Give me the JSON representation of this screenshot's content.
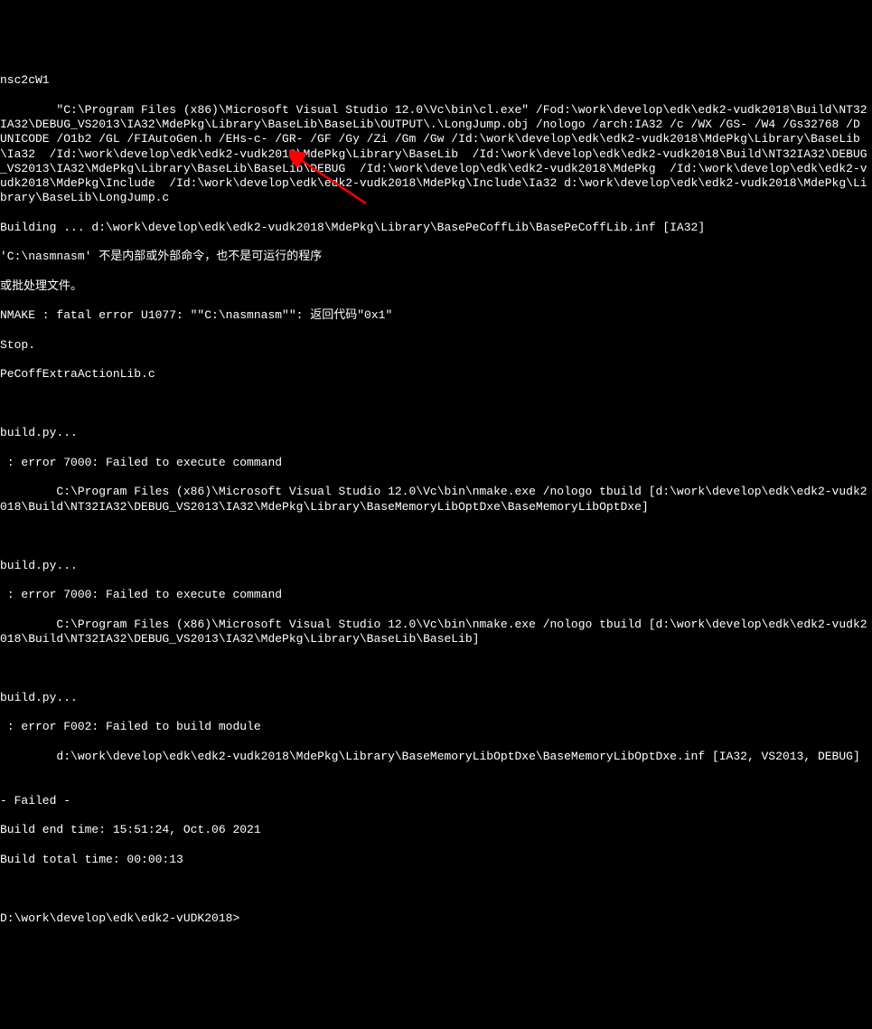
{
  "terminal": {
    "lines": [
      "nsc2cW1",
      "        \"C:\\Program Files (x86)\\Microsoft Visual Studio 12.0\\Vc\\bin\\cl.exe\" /Fod:\\work\\develop\\edk\\edk2-vudk2018\\Build\\NT32IA32\\DEBUG_VS2013\\IA32\\MdePkg\\Library\\BaseLib\\BaseLib\\OUTPUT\\.\\LongJump.obj /nologo /arch:IA32 /c /WX /GS- /W4 /Gs32768 /D UNICODE /O1b2 /GL /FIAutoGen.h /EHs-c- /GR- /GF /Gy /Zi /Gm /Gw /Id:\\work\\develop\\edk\\edk2-vudk2018\\MdePkg\\Library\\BaseLib\\Ia32  /Id:\\work\\develop\\edk\\edk2-vudk2018\\MdePkg\\Library\\BaseLib  /Id:\\work\\develop\\edk\\edk2-vudk2018\\Build\\NT32IA32\\DEBUG_VS2013\\IA32\\MdePkg\\Library\\BaseLib\\BaseLib\\DEBUG  /Id:\\work\\develop\\edk\\edk2-vudk2018\\MdePkg  /Id:\\work\\develop\\edk\\edk2-vudk2018\\MdePkg\\Include  /Id:\\work\\develop\\edk\\edk2-vudk2018\\MdePkg\\Include\\Ia32 d:\\work\\develop\\edk\\edk2-vudk2018\\MdePkg\\Library\\BaseLib\\LongJump.c",
      "Building ... d:\\work\\develop\\edk\\edk2-vudk2018\\MdePkg\\Library\\BasePeCoffLib\\BasePeCoffLib.inf [IA32]",
      "'C:\\nasmnasm' 不是内部或外部命令，也不是可运行的程序",
      "或批处理文件。",
      "NMAKE : fatal error U1077: \"\"C:\\nasmnasm\"\": 返回代码\"0x1\"",
      "Stop.",
      "PeCoffExtraActionLib.c",
      "",
      "",
      "build.py...",
      " : error 7000: Failed to execute command",
      "        C:\\Program Files (x86)\\Microsoft Visual Studio 12.0\\Vc\\bin\\nmake.exe /nologo tbuild [d:\\work\\develop\\edk\\edk2-vudk2018\\Build\\NT32IA32\\DEBUG_VS2013\\IA32\\MdePkg\\Library\\BaseMemoryLibOptDxe\\BaseMemoryLibOptDxe]",
      "",
      "",
      "build.py...",
      " : error 7000: Failed to execute command",
      "        C:\\Program Files (x86)\\Microsoft Visual Studio 12.0\\Vc\\bin\\nmake.exe /nologo tbuild [d:\\work\\develop\\edk\\edk2-vudk2018\\Build\\NT32IA32\\DEBUG_VS2013\\IA32\\MdePkg\\Library\\BaseLib\\BaseLib]",
      "",
      "",
      "build.py...",
      " : error F002: Failed to build module",
      "        d:\\work\\develop\\edk\\edk2-vudk2018\\MdePkg\\Library\\BaseMemoryLibOptDxe\\BaseMemoryLibOptDxe.inf [IA32, VS2013, DEBUG]",
      "",
      "- Failed -",
      "Build end time: 15:51:24, Oct.06 2021",
      "Build total time: 00:00:13",
      "",
      ""
    ],
    "prompt": "D:\\work\\develop\\edk\\edk2-vUDK2018>"
  }
}
